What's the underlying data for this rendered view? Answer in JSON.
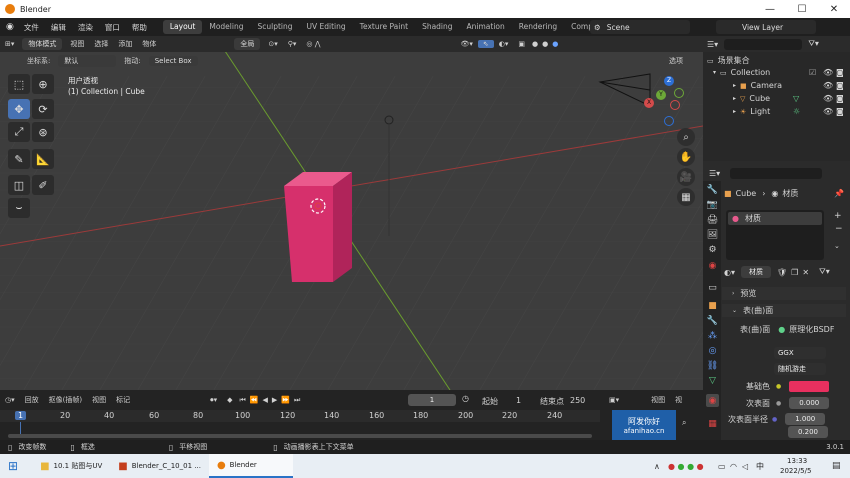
{
  "window": {
    "title": "Blender",
    "minimize": "—",
    "maximize": "☐",
    "close": "✕"
  },
  "topbar": {
    "menus": [
      "文件",
      "编辑",
      "渲染",
      "窗口",
      "帮助"
    ],
    "workspaces": [
      "Layout",
      "Modeling",
      "Sculpting",
      "UV Editing",
      "Texture Paint",
      "Shading",
      "Animation",
      "Rendering",
      "Compositing"
    ],
    "active_workspace": "Layout",
    "scene": "Scene",
    "view_layer": "View Layer"
  },
  "viewport_header": {
    "mode": "物体模式",
    "menus": [
      "视图",
      "选择",
      "添加",
      "物体"
    ],
    "transform_orientation": "全局",
    "coordinate_label": "坐标系:",
    "coordinate_value": "默认",
    "drag_label": "拖动:",
    "drag_value": "Select Box",
    "options_label": "选项"
  },
  "viewport": {
    "view_name": "用户透视",
    "collection_path": "(1) Collection | Cube",
    "gizmo_axes": {
      "x": "X",
      "y": "Y",
      "z": "Z"
    },
    "cube_color": "#d6306c"
  },
  "outliner": {
    "root": "场景集合",
    "items": [
      {
        "name": "Collection"
      },
      {
        "name": "Camera"
      },
      {
        "name": "Cube"
      },
      {
        "name": "Light"
      }
    ]
  },
  "properties": {
    "breadcrumb_object": "Cube",
    "breadcrumb_tab": "材质",
    "slot_name": "材质",
    "material_name": "材质",
    "panel_preview": "预览",
    "panel_surface": "表(曲)面",
    "surface_label": "表(曲)面",
    "surface_shader": "原理化BSDF",
    "distribution": "GGX",
    "subsurface_method": "随机游走",
    "base_color_label": "基础色",
    "base_color": "#e8305f",
    "subsurface_label": "次表面",
    "subsurface_value": "0.000",
    "subsurface_radius_label": "次表面半径",
    "radius_1": "1.000",
    "radius_2": "0.200"
  },
  "timeline": {
    "menus": [
      "回放",
      "抠像(插帧)",
      "视图",
      "标记"
    ],
    "current_frame": "1",
    "start_label": "起始",
    "start_value": "1",
    "end_label": "结束点",
    "end_value": "250",
    "ticks": [
      "1",
      "20",
      "40",
      "60",
      "80",
      "100",
      "120",
      "140",
      "160",
      "180",
      "200",
      "220",
      "240"
    ],
    "right_menu": "视图",
    "right_menu2": "视"
  },
  "statusbar": {
    "items": [
      "改变帧数",
      "框选",
      "平移视图",
      "动画播影表上下文菜单"
    ],
    "version": "3.0.1"
  },
  "watermark": {
    "line1": "阿发你好",
    "line2": "afanihao.cn"
  },
  "taskbar": {
    "items": [
      "10.1 贴图与UV",
      "Blender_C_10_01 ...",
      "Blender"
    ],
    "active": "Blender",
    "ime": "中",
    "time": "13:33",
    "date": "2022/5/5"
  }
}
